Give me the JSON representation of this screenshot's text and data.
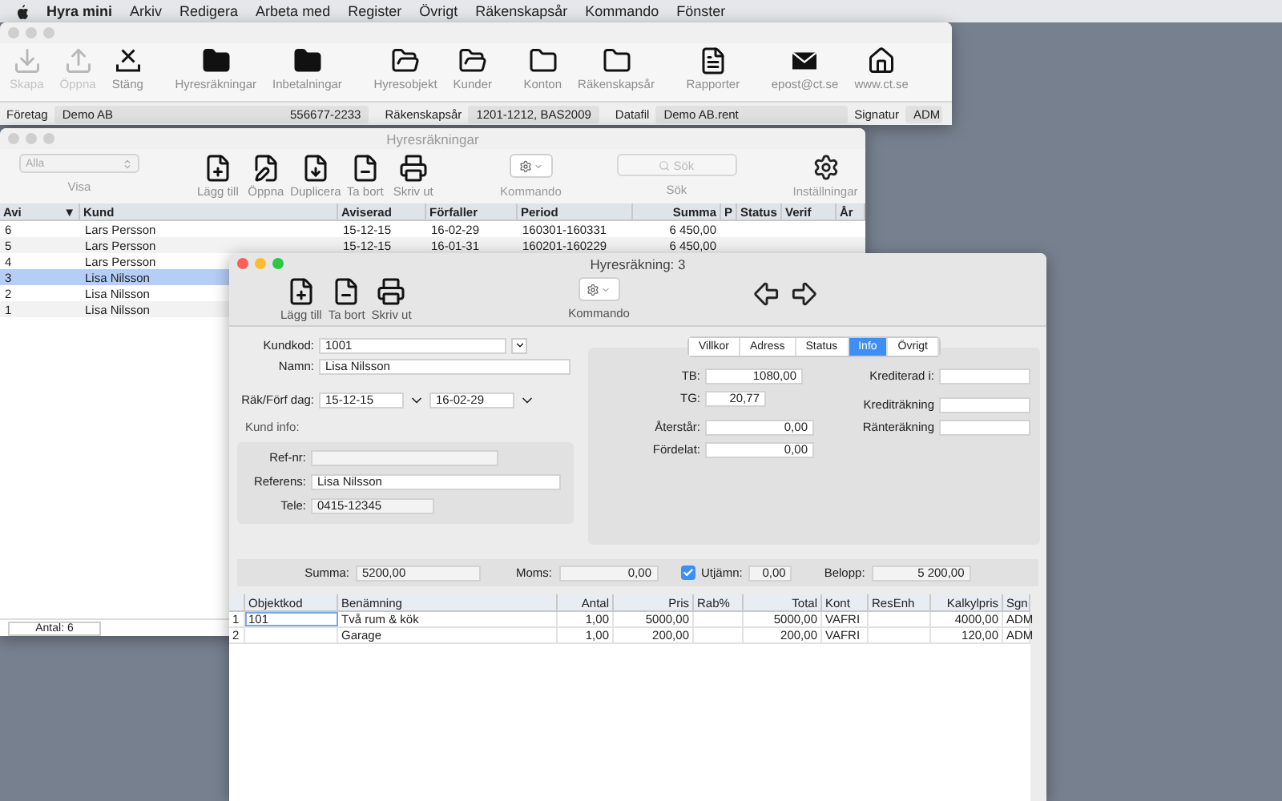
{
  "menu_bar": {
    "app_name": "Hyra mini",
    "items": [
      "Arkiv",
      "Redigera",
      "Arbeta med",
      "Register",
      "Övrigt",
      "Räkenskapsår",
      "Kommando",
      "Fönster"
    ]
  },
  "main_window": {
    "active": false,
    "toolbar_groups": [
      {
        "items": [
          {
            "label": "Skapa",
            "disabled": true
          },
          {
            "label": "Öppna",
            "disabled": true
          },
          {
            "label": "Stäng",
            "disabled": false
          }
        ]
      },
      {
        "items": [
          {
            "label": "Hyresräkningar",
            "disabled": false
          },
          {
            "label": "Inbetalningar",
            "disabled": false
          }
        ]
      },
      {
        "items": [
          {
            "label": "Hyresobjekt",
            "disabled": false
          },
          {
            "label": "Kunder",
            "disabled": false
          }
        ]
      },
      {
        "items": [
          {
            "label": "Konton",
            "disabled": false
          },
          {
            "label": "Räkenskapsår",
            "disabled": false
          }
        ]
      },
      {
        "items": [
          {
            "label": "Rapporter",
            "disabled": false
          }
        ]
      },
      {
        "items": [
          {
            "label": "epost@ct.se",
            "disabled": false
          },
          {
            "label": "www.ct.se",
            "disabled": false
          }
        ]
      }
    ],
    "status_bar": {
      "company_label": "Företag",
      "company": "Demo AB",
      "org_number": "556677-2233",
      "fiscal_year_label": "Räkenskapsår",
      "fiscal_year": "1201-1212, BAS2009",
      "datafile_label": "Datafil",
      "datafile": "Demo AB.rent",
      "signature_label": "Signatur",
      "signature": "ADM"
    }
  },
  "list_window": {
    "title": "Hyresräkningar",
    "active": false,
    "filter": {
      "value": "Alla",
      "label": "Visa"
    },
    "buttons": [
      "Lägg till",
      "Öppna",
      "Duplicera",
      "Ta bort",
      "Skriv ut"
    ],
    "command_label": "Kommando",
    "search": {
      "placeholder": "Sök",
      "label": "Sök"
    },
    "settings_label": "Inställningar",
    "table": {
      "columns": [
        {
          "label": "Avi",
          "sort_mark": "▼"
        },
        {
          "label": "Kund"
        },
        {
          "label": "Aviserad"
        },
        {
          "label": "Förfaller"
        },
        {
          "label": "Period"
        },
        {
          "label": "Summa"
        },
        {
          "label": "P"
        },
        {
          "label": "Status"
        },
        {
          "label": "Verif"
        },
        {
          "label": "År"
        }
      ],
      "rows": [
        {
          "selected": false,
          "cells": [
            "6",
            "Lars Persson",
            "15-12-15",
            "16-02-29",
            "160301-160331",
            "6 450,00"
          ]
        },
        {
          "selected": false,
          "cells": [
            "5",
            "Lars Persson",
            "15-12-15",
            "16-01-31",
            "160201-160229",
            "6 450,00"
          ]
        },
        {
          "selected": false,
          "cells": [
            "4",
            "Lars Persson"
          ]
        },
        {
          "selected": true,
          "cells": [
            "3",
            "Lisa Nilsson"
          ]
        },
        {
          "selected": false,
          "cells": [
            "2",
            "Lisa Nilsson"
          ]
        },
        {
          "selected": false,
          "cells": [
            "1",
            "Lisa Nilsson"
          ]
        }
      ]
    },
    "footer": "Antal: 6"
  },
  "invoice_window": {
    "title": "Hyresräkning: 3",
    "active": true,
    "buttons": [
      "Lägg till",
      "Ta bort",
      "Skriv ut"
    ],
    "command_label": "Kommando",
    "customer": {
      "code_label": "Kundkod:",
      "code": "1001",
      "name_label": "Namn:",
      "name": "Lisa Nilsson",
      "dates_label": "Räk/Förf dag:",
      "invoice_date": "15-12-15",
      "due_date": "16-02-29",
      "info_heading": "Kund info:",
      "ref_label": "Ref-nr:",
      "reference_label": "Referens:",
      "reference": "Lisa Nilsson",
      "phone_label": "Tele:",
      "phone": "0415-12345"
    },
    "tabs": [
      {
        "label": "Villkor",
        "selected": false
      },
      {
        "label": "Adress",
        "selected": false
      },
      {
        "label": "Status",
        "selected": false
      },
      {
        "label": "Info",
        "selected": true
      },
      {
        "label": "Övrigt",
        "selected": false
      }
    ],
    "info": {
      "left": [
        {
          "label": "TB:",
          "value": "1080,00"
        },
        {
          "label": "TG:",
          "value": "20,77"
        },
        {
          "label": "Återstår:",
          "value": "0,00"
        },
        {
          "label": "Fördelat:",
          "value": "0,00"
        }
      ],
      "right": [
        {
          "label": "Krediterad i:"
        },
        {
          "label": "Krediträkning"
        },
        {
          "label": "Ränteräkning"
        }
      ]
    },
    "totals": {
      "sum_label": "Summa:",
      "sum": "5200,00",
      "vat_label": "Moms:",
      "vat": "0,00",
      "rounding_label": "Utjämn:",
      "rounding_checked": true,
      "rounding": "0,00",
      "amount_label": "Belopp:",
      "amount": "5 200,00"
    },
    "lines": {
      "columns": [
        "Objektkod",
        "Benämning",
        "Antal",
        "Pris",
        "Rab%",
        "Total",
        "Kont",
        "ResEnh",
        "Kalkylpris",
        "Sgn"
      ],
      "rows": [
        {
          "number": "1",
          "focused": true,
          "cells": [
            "101",
            "Två rum & kök",
            "1,00",
            "5000,00",
            null,
            "5000,00",
            "VAFRI",
            null,
            "4000,00",
            "ADM"
          ]
        },
        {
          "number": "2",
          "focused": false,
          "cells": [
            null,
            "Garage",
            "1,00",
            "200,00",
            null,
            "200,00",
            "VAFRI",
            null,
            "120,00",
            "ADM"
          ]
        }
      ]
    }
  }
}
